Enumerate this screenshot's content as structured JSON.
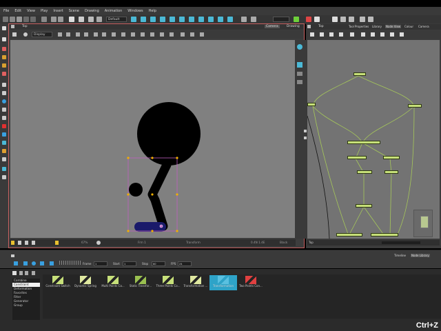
{
  "menu": [
    "File",
    "Edit",
    "View",
    "Play",
    "Insert",
    "Scene",
    "Drawing",
    "Animation",
    "Windows",
    "Help"
  ],
  "toolbar": {
    "workspace_select": "Default"
  },
  "camera_view": {
    "title": "Top",
    "tabs": [
      "Camera",
      "Drawing"
    ],
    "display_select": "Display",
    "status": {
      "zoom": "67%",
      "frame": "Frm 1",
      "mode": "Transform",
      "coords": "0.4N 1.4E",
      "color": "Black"
    }
  },
  "node_view": {
    "title": "Top",
    "tabs": [
      "Tool Properties",
      "Library",
      "Node View",
      "Colour",
      "Camera"
    ],
    "footer": "Top"
  },
  "timeline": {
    "tabs": [
      "Timeline",
      "Node Library"
    ],
    "frame_label": "Frame",
    "frame_value": "1",
    "start_label": "Start",
    "start_value": "1",
    "stop_label": "Stop",
    "stop_value": "60",
    "fps_label": "FPS",
    "fps_value": "24"
  },
  "library": {
    "categories": [
      "Combine",
      "Constraint",
      "Deformation",
      "Favorites",
      "Filter",
      "Generator",
      "Group"
    ],
    "selected_category": "Constraint",
    "items": [
      {
        "label": "Constraint Switch",
        "icon": "constraint-switch-icon"
      },
      {
        "label": "Dynamic Spring",
        "icon": "dynamic-spring-icon"
      },
      {
        "label": "Multi Points Co...",
        "icon": "multi-points-icon"
      },
      {
        "label": "Static Transfor...",
        "icon": "static-transform-icon"
      },
      {
        "label": "Three Points Co...",
        "icon": "three-points-icon"
      },
      {
        "label": "Transformation ...",
        "icon": "transformation-icon"
      },
      {
        "label": "Transformation",
        "icon": "transformation-selected-icon"
      },
      {
        "label": "Two Points Con...",
        "icon": "two-points-icon"
      }
    ],
    "selected_item": "Transformation"
  },
  "watermark": "Ctrl+Z",
  "colors": {
    "node": "#c7e07a",
    "wire": "#a6c85a",
    "selection": "#c060c0",
    "accent": "#2ea3c8",
    "canvas": "#808080"
  }
}
